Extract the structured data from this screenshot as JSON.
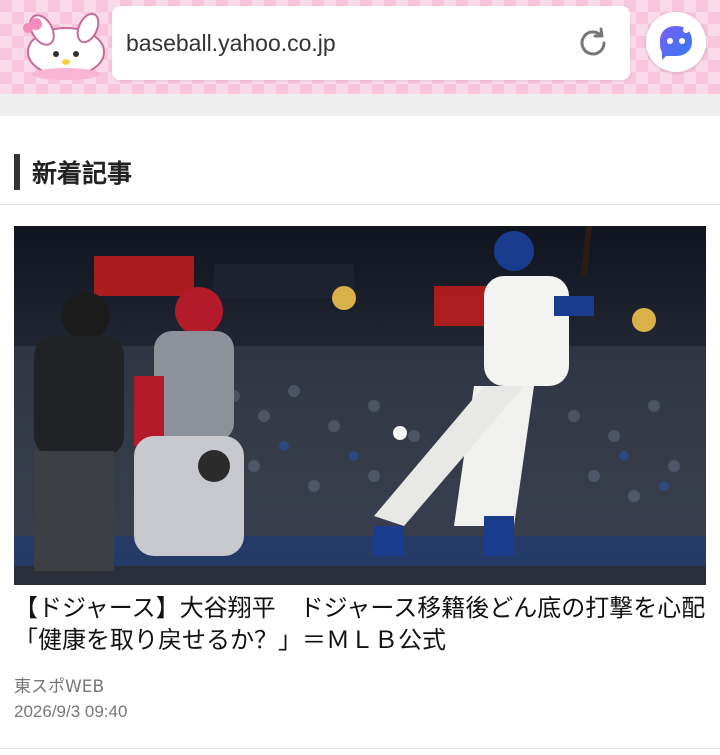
{
  "browser": {
    "url": "baseball.yahoo.co.jp",
    "reload_icon": "reload-icon",
    "assistant_icon": "assistant-chat-icon"
  },
  "section": {
    "title": "新着記事"
  },
  "article": {
    "headline": "【ドジャース】大谷翔平　ドジャース移籍後どん底の打撃を心配　「健康を取り戻せるか？」＝ＭＬＢ公式",
    "source": "東スポWEB",
    "datetime": "2026/9/3 09:40",
    "image_alt": "baseball-game-photo"
  },
  "colors": {
    "topbar_pink": "#f7c5dc",
    "assistant_blue": "#4f5cf0"
  }
}
